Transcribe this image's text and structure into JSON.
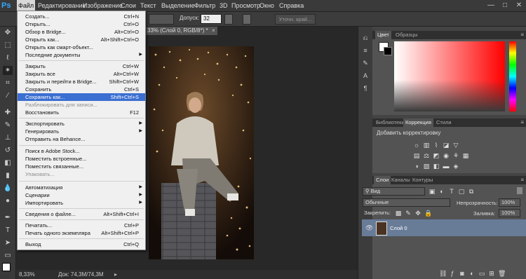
{
  "app": {
    "logo": "Ps"
  },
  "menubar": {
    "items": [
      "Файл",
      "Редактирование",
      "Изображение",
      "Слои",
      "Текст",
      "Выделение",
      "Фильтр",
      "3D",
      "Просмотр",
      "Окно",
      "Справка"
    ],
    "win_min": "—",
    "win_max": "□",
    "win_close": "✕"
  },
  "options": {
    "tolerance_label": "Допуск:",
    "tolerance_value": "32",
    "refine_edge": "Уточн. край..."
  },
  "document": {
    "tab_title": "33% (Слой 0, RGB/8*) *",
    "tab_close": "×",
    "zoom": "8,33%",
    "doc_info": "Док: 74,3M/74,3M"
  },
  "file_menu": {
    "items": [
      {
        "label": "Создать...",
        "shortcut": "Ctrl+N"
      },
      {
        "label": "Открыть...",
        "shortcut": "Ctrl+O"
      },
      {
        "label": "Обзор в Bridge...",
        "shortcut": "Alt+Ctrl+O"
      },
      {
        "label": "Открыть как...",
        "shortcut": "Alt+Shift+Ctrl+O"
      },
      {
        "label": "Открыть как смарт-объект...",
        "shortcut": ""
      },
      {
        "label": "Последние документы",
        "shortcut": "",
        "submenu": true
      },
      {
        "label": "Закрыть",
        "shortcut": "Ctrl+W"
      },
      {
        "label": "Закрыть все",
        "shortcut": "Alt+Ctrl+W"
      },
      {
        "label": "Закрыть и перейти в Bridge...",
        "shortcut": "Shift+Ctrl+W"
      },
      {
        "label": "Сохранить",
        "shortcut": "Ctrl+S"
      },
      {
        "label": "Сохранить как...",
        "shortcut": "Shift+Ctrl+S",
        "highlighted": true
      },
      {
        "label": "Разблокировать для записи...",
        "shortcut": "",
        "disabled": true
      },
      {
        "label": "Восстановить",
        "shortcut": "F12"
      },
      {
        "label": "Экспортировать",
        "shortcut": "",
        "submenu": true
      },
      {
        "label": "Генерировать",
        "shortcut": "",
        "submenu": true
      },
      {
        "label": "Отправить на Behance...",
        "shortcut": ""
      },
      {
        "label": "Поиск в Adobe Stock...",
        "shortcut": ""
      },
      {
        "label": "Поместить встроенные...",
        "shortcut": ""
      },
      {
        "label": "Поместить связанные...",
        "shortcut": ""
      },
      {
        "label": "Упаковать...",
        "shortcut": "",
        "disabled": true
      },
      {
        "label": "Автоматизация",
        "shortcut": "",
        "submenu": true
      },
      {
        "label": "Сценарии",
        "shortcut": "",
        "submenu": true
      },
      {
        "label": "Импортировать",
        "shortcut": "",
        "submenu": true
      },
      {
        "label": "Сведения о файле...",
        "shortcut": "Alt+Shift+Ctrl+I"
      },
      {
        "label": "Печатать...",
        "shortcut": "Ctrl+P"
      },
      {
        "label": "Печать одного экземпляра",
        "shortcut": "Alt+Shift+Ctrl+P"
      },
      {
        "label": "Выход",
        "shortcut": "Ctrl+Q"
      }
    ]
  },
  "color_panel": {
    "tabs": [
      "Цвет",
      "Образцы"
    ],
    "hue_color": "#ff0000"
  },
  "adjust_panel": {
    "tabs": [
      "Библиотеки",
      "Коррекция",
      "Стили"
    ],
    "title": "Добавить корректировку"
  },
  "layers_panel": {
    "tabs": [
      "Слои",
      "Каналы",
      "Контуры"
    ],
    "filter_label": "Вид",
    "blend_mode": "Обычные",
    "opacity_label": "Непрозрачность:",
    "opacity_value": "100%",
    "lock_label": "Закрепить:",
    "fill_label": "Заливка:",
    "fill_value": "100%",
    "layer_name": "Слой 0"
  }
}
